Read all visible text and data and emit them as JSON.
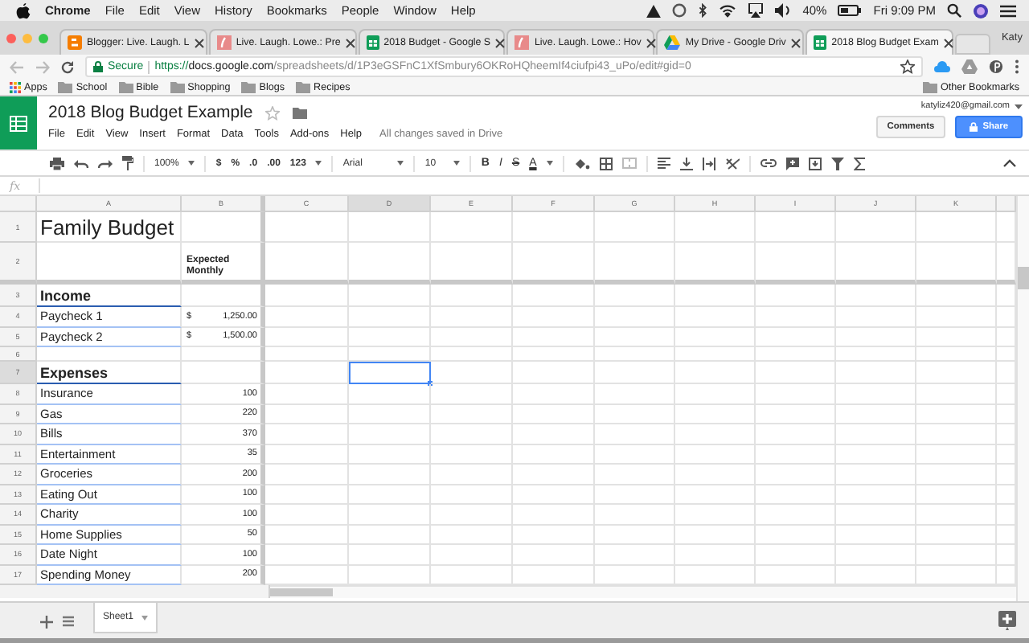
{
  "menubar": {
    "app": "Chrome",
    "items": [
      "File",
      "Edit",
      "View",
      "History",
      "Bookmarks",
      "People",
      "Window",
      "Help"
    ],
    "battery": "40%",
    "clock": "Fri 9:09 PM"
  },
  "tabs": [
    {
      "kind": "blogger",
      "title": "Blogger: Live. Laugh. L",
      "selected": false
    },
    {
      "kind": "blog",
      "title": "Live. Laugh. Lowe.: Pre",
      "selected": false
    },
    {
      "kind": "sheets",
      "title": "2018 Budget - Google S",
      "selected": false
    },
    {
      "kind": "blog",
      "title": "Live. Laugh. Lowe.: Hov",
      "selected": false
    },
    {
      "kind": "drive",
      "title": "My Drive - Google Driv",
      "selected": false
    },
    {
      "kind": "sheets",
      "title": "2018 Blog Budget Exam",
      "selected": true
    }
  ],
  "profile": "Katy",
  "address": {
    "secure": "Secure",
    "url_parts": [
      "https://",
      "docs.google.com",
      "/spreadsheets/d/1P3eGSFnC1XfSmbury6OKRoHQheemIf4ciufpi43_uPo/edit#gid=0"
    ]
  },
  "bookmarks": {
    "apps": "Apps",
    "folders": [
      "School",
      "Bible",
      "Shopping",
      "Blogs",
      "Recipes"
    ],
    "other": "Other Bookmarks"
  },
  "doc": {
    "title": "2018 Blog Budget Example",
    "menus": [
      "File",
      "Edit",
      "View",
      "Insert",
      "Format",
      "Data",
      "Tools",
      "Add-ons",
      "Help"
    ],
    "save_status": "All changes saved in Drive",
    "account": "katyliz420@gmail.com",
    "comments": "Comments",
    "share": "Share"
  },
  "toolbar": {
    "zoom": "100%",
    "number_formats": [
      "$",
      "%",
      ".0",
      ".00",
      "123"
    ],
    "font": "Arial",
    "font_size": "10",
    "text_styles": [
      "B",
      "I",
      "S",
      "A"
    ]
  },
  "formula_bar": {
    "label": "fx"
  },
  "columns": [
    {
      "label": "A",
      "selected": false
    },
    {
      "label": "B",
      "selected": false
    },
    {
      "label": "C",
      "selected": false
    },
    {
      "label": "D",
      "selected": true
    },
    {
      "label": "E",
      "selected": false
    },
    {
      "label": "F",
      "selected": false
    },
    {
      "label": "G",
      "selected": false
    },
    {
      "label": "H",
      "selected": false
    },
    {
      "label": "I",
      "selected": false
    },
    {
      "label": "J",
      "selected": false
    },
    {
      "label": "K",
      "selected": false
    }
  ],
  "rows": [
    {
      "number": "1",
      "kind": "title",
      "label": "Family Budget",
      "selected": false
    },
    {
      "number": "2",
      "kind": "heading",
      "amount": "Expected Monthly",
      "selected": false
    },
    {
      "number": "3",
      "kind": "section",
      "label": "Income",
      "selected": false
    },
    {
      "number": "4",
      "kind": "item",
      "label": "Paycheck 1",
      "currency": "$",
      "amount": "1,250.00",
      "selected": false
    },
    {
      "number": "5",
      "kind": "item",
      "label": "Paycheck 2",
      "currency": "$",
      "amount": "1,500.00",
      "selected": false
    },
    {
      "number": "6",
      "kind": "blank",
      "selected": false
    },
    {
      "number": "7",
      "kind": "section",
      "label": "Expenses",
      "selected": true
    },
    {
      "number": "8",
      "kind": "item",
      "label": "Insurance",
      "amount": "100",
      "selected": false
    },
    {
      "number": "9",
      "kind": "item",
      "label": "Gas",
      "amount": "220",
      "selected": false
    },
    {
      "number": "10",
      "kind": "item",
      "label": "Bills",
      "amount": "370",
      "selected": false
    },
    {
      "number": "11",
      "kind": "item",
      "label": "Entertainment",
      "amount": "35",
      "selected": false
    },
    {
      "number": "12",
      "kind": "item",
      "label": "Groceries",
      "amount": "200",
      "selected": false
    },
    {
      "number": "13",
      "kind": "item",
      "label": "Eating Out",
      "amount": "100",
      "selected": false
    },
    {
      "number": "14",
      "kind": "item",
      "label": "Charity",
      "amount": "100",
      "selected": false
    },
    {
      "number": "15",
      "kind": "item",
      "label": "Home Supplies",
      "amount": "50",
      "selected": false
    },
    {
      "number": "16",
      "kind": "item",
      "label": "Date Night",
      "amount": "100",
      "selected": false
    },
    {
      "number": "17",
      "kind": "item",
      "label": "Spending Money",
      "amount": "200",
      "selected": false
    }
  ],
  "sheets": [
    {
      "name": "Sheet1",
      "selected": true
    }
  ]
}
